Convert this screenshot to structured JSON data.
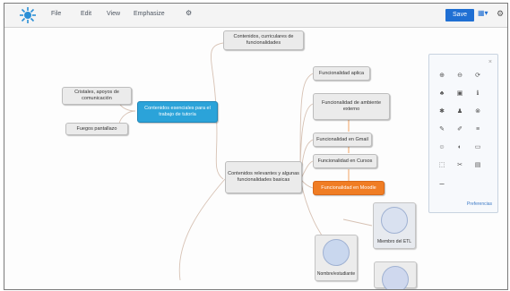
{
  "menubar": {
    "items": [
      "File",
      "Edit",
      "View",
      "Emphasize"
    ],
    "gear_glyph": "⚙",
    "save_label": "Save",
    "view_glyph": "▦▾",
    "settings_glyph": "⚙"
  },
  "mindmap": {
    "central": "Contenidos esenciales para el trabajo de tutoría",
    "left_nodes": [
      "Cristales, apoyos de comunicación",
      "Fuegos pantallazo"
    ],
    "top_node": "Contenidos, curriculares de funcionalidades",
    "mid_node": "Contenidos relevantes y algunas funcionalidades basicas",
    "right_nodes": [
      "Funcionalidad aplica",
      "Funcionalidad de ambiente externo",
      "Funcionalidad en Gmail",
      "Funcionalidad en Cursos",
      "Funcionalidad en Moodle"
    ],
    "images": [
      "Nombre/estudiante",
      "Miembro del ETL"
    ]
  },
  "panel": {
    "close_glyph": "×",
    "buttons": [
      "⊕",
      "⊖",
      "⟳",
      "♣",
      "▣",
      "ℹ",
      "✱",
      "♟",
      "⊗",
      "✎",
      "✐",
      "≡",
      "☺",
      "◐",
      "▭",
      "⬚",
      "✂",
      "▤",
      "⚊"
    ],
    "link": "Preferencias"
  }
}
